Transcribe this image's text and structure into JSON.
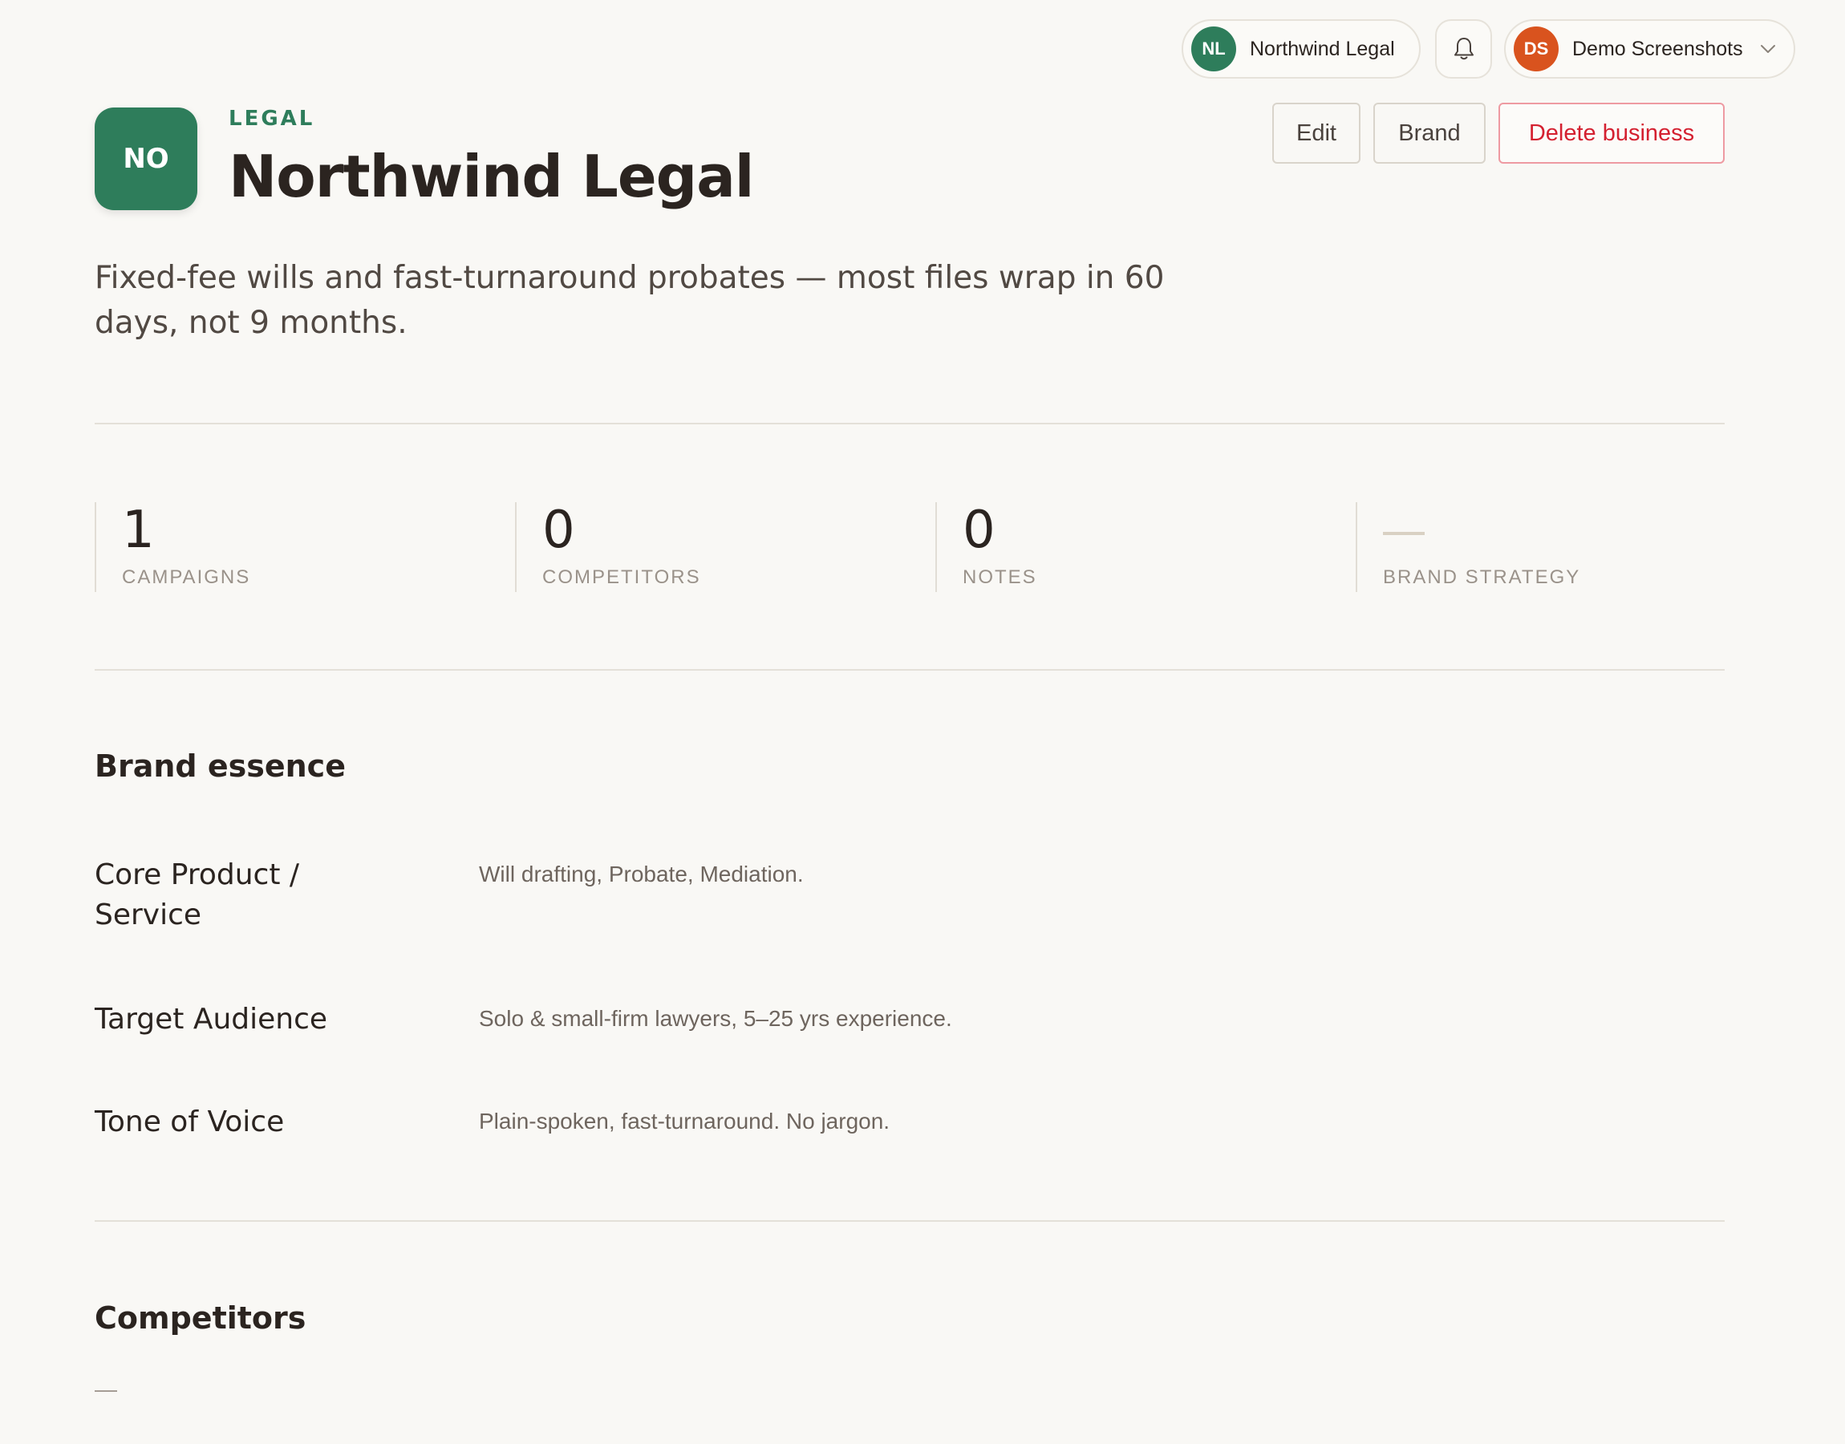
{
  "topbar": {
    "business_switcher": {
      "initials": "NL",
      "name": "Northwind Legal",
      "avatar_color": "#2e7d5b"
    },
    "notifications": {
      "icon": "bell-icon"
    },
    "user_menu": {
      "initials": "DS",
      "name": "Demo Screenshots",
      "avatar_color": "#d9531e",
      "icon": "chevron-down-icon"
    }
  },
  "header": {
    "logo_initials": "NO",
    "logo_color": "#2e7d5b",
    "category": "LEGAL",
    "category_color": "#2e7d5b",
    "title": "Northwind Legal",
    "tagline": "Fixed-fee wills and fast-turnaround probates — most files wrap in 60 days, not 9 months."
  },
  "actions": {
    "edit_label": "Edit",
    "brand_label": "Brand",
    "delete_label": "Delete business",
    "delete_color": "#d42030"
  },
  "stats": [
    {
      "value": "1",
      "label": "CAMPAIGNS"
    },
    {
      "value": "0",
      "label": "COMPETITORS"
    },
    {
      "value": "0",
      "label": "NOTES"
    },
    {
      "value": "",
      "label": "BRAND STRATEGY"
    }
  ],
  "brand_essence": {
    "title": "Brand essence",
    "fields": [
      {
        "label": "Core Product / Service",
        "value": "Will drafting, Probate, Mediation."
      },
      {
        "label": "Target Audience",
        "value": "Solo & small-firm lawyers, 5–25 yrs experience."
      },
      {
        "label": "Tone of Voice",
        "value": "Plain-spoken, fast-turnaround. No jargon."
      }
    ]
  },
  "competitors": {
    "title": "Competitors"
  }
}
